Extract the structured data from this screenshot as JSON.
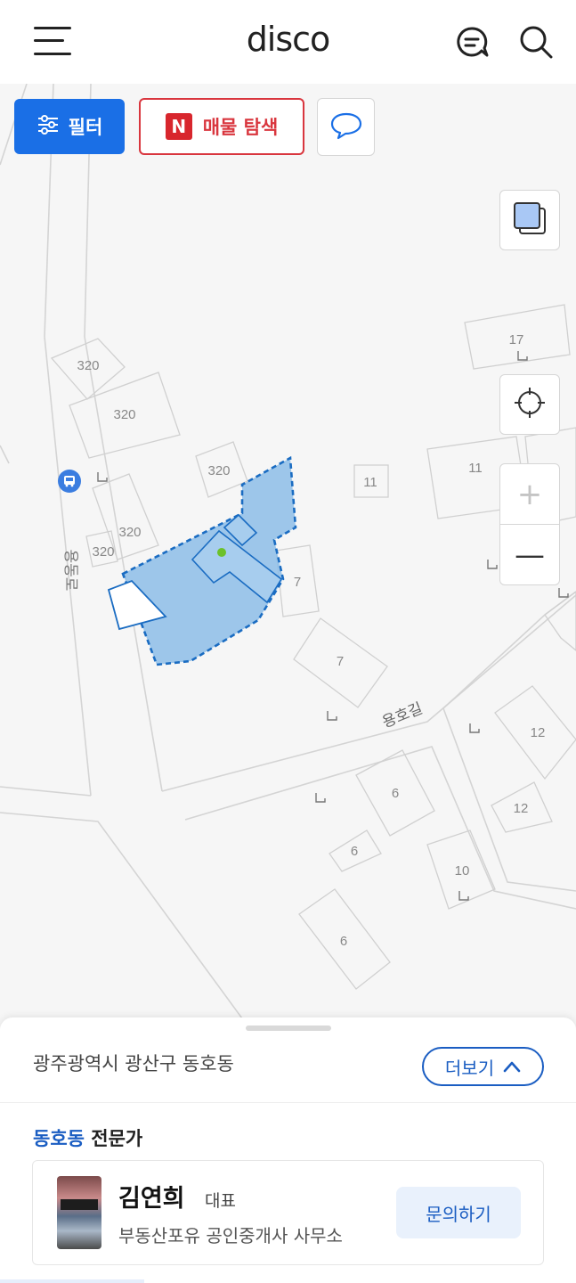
{
  "header": {
    "logo": "disco",
    "menu_icon": "menu-icon",
    "chat_icon": "chat-icon",
    "search_icon": "search-icon"
  },
  "toolbar": {
    "filter_label": "필터",
    "listing_badge": "N",
    "listing_label": "매물 탐색"
  },
  "map": {
    "road_label_vertical": "용동로",
    "road_label_bottom": "용호길",
    "lot_numbers": [
      "320",
      "320",
      "320",
      "320",
      "320",
      "11",
      "11",
      "17",
      "7",
      "7",
      "6",
      "6",
      "6",
      "10",
      "12",
      "12"
    ],
    "colors": {
      "selection_fill": "#8dbde8",
      "selection_stroke": "#1a6cc2",
      "marker": "#6cc12a"
    }
  },
  "zoom": {
    "in": "+",
    "out": "—"
  },
  "sheet": {
    "address": "광주광역시 광산구 동호동",
    "more_label": "더보기",
    "section_highlight": "동호동",
    "section_rest": " 전문가",
    "agent": {
      "name": "김연희",
      "role": "대표",
      "office": "부동산포유 공인중개사 사무소",
      "inquiry_label": "문의하기"
    }
  }
}
